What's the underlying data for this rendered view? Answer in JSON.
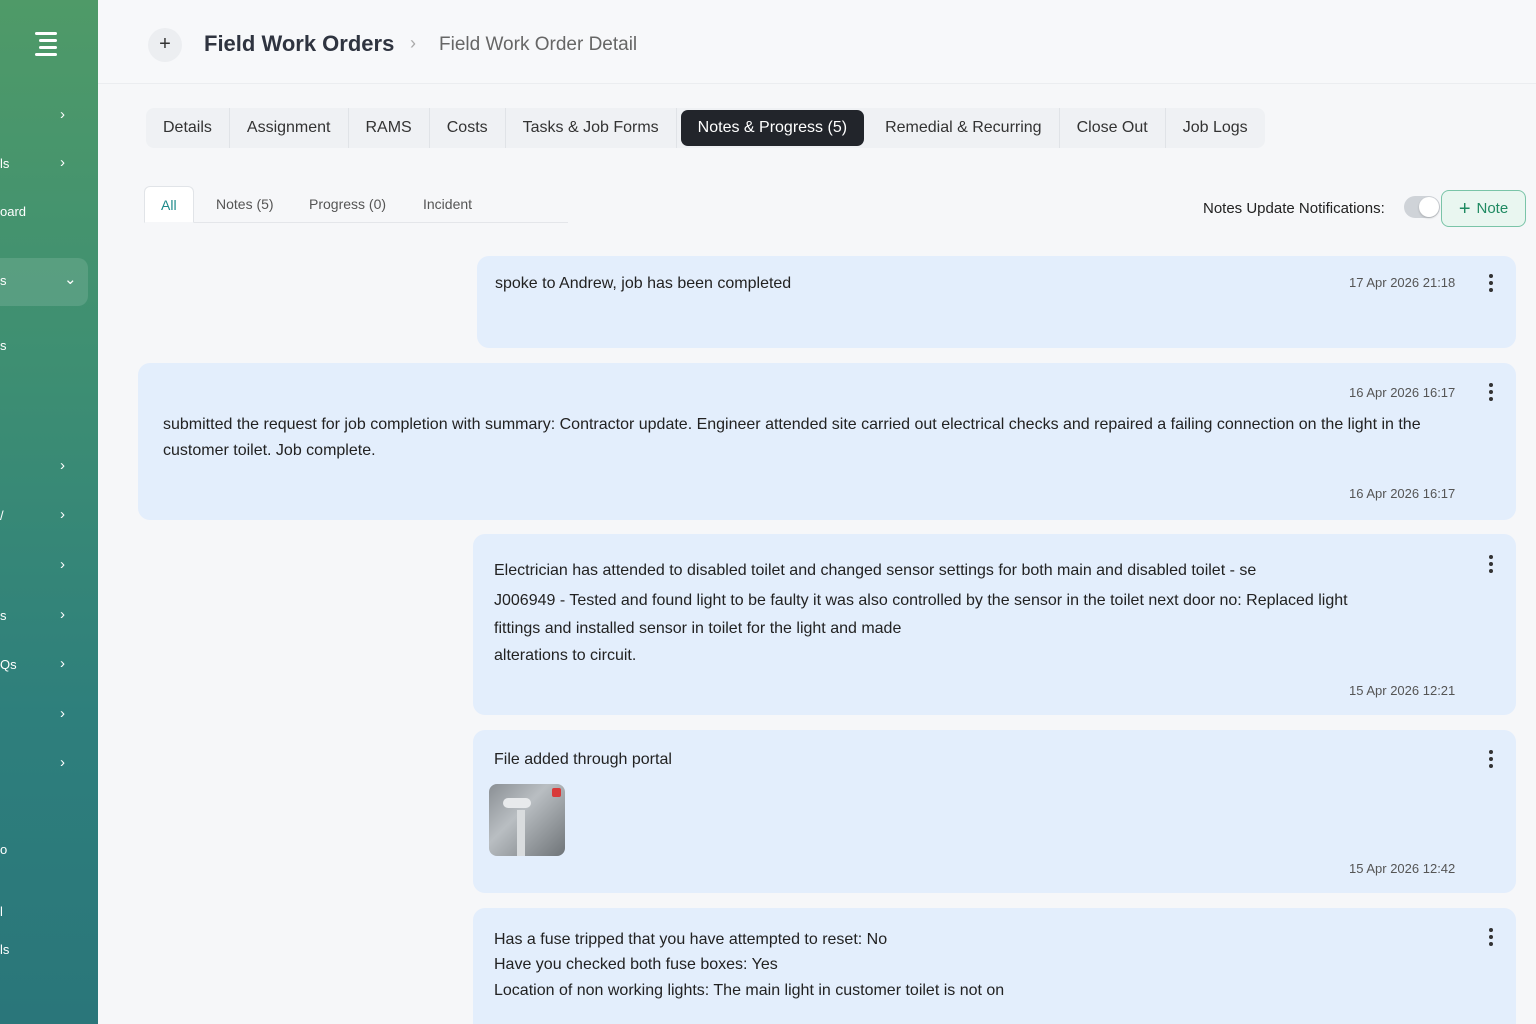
{
  "sidebar": {
    "items": [
      {
        "label": "",
        "chevron": "›"
      },
      {
        "label": "ls",
        "chevron": "›"
      },
      {
        "label": "oard",
        "chevron": ""
      },
      {
        "label": "s",
        "chevron": "⌄"
      },
      {
        "label": "s",
        "chevron": ""
      },
      {
        "label": "",
        "chevron": "›"
      },
      {
        "label": "/",
        "chevron": "›"
      },
      {
        "label": "",
        "chevron": "›"
      },
      {
        "label": "s",
        "chevron": "›"
      },
      {
        "label": "Qs",
        "chevron": "›"
      },
      {
        "label": "",
        "chevron": "›"
      },
      {
        "label": "",
        "chevron": "›"
      },
      {
        "label": "o",
        "chevron": ""
      },
      {
        "label": "l",
        "chevron": ""
      },
      {
        "label": "ls",
        "chevron": ""
      }
    ]
  },
  "header": {
    "plus": "+",
    "breadcrumb_main": "Field Work Orders",
    "breadcrumb_sep": "›",
    "breadcrumb_sub": "Field Work Order Detail"
  },
  "tabs": [
    {
      "label": "Details"
    },
    {
      "label": "Assignment"
    },
    {
      "label": "RAMS"
    },
    {
      "label": "Costs"
    },
    {
      "label": "Tasks & Job Forms"
    },
    {
      "label": "Notes & Progress (5)"
    },
    {
      "label": "Remedial & Recurring"
    },
    {
      "label": "Close Out"
    },
    {
      "label": "Job Logs"
    }
  ],
  "active_tab": "Notes & Progress (5)",
  "subtabs": [
    {
      "label": "All"
    },
    {
      "label": "Notes (5)"
    },
    {
      "label": "Progress (0)"
    },
    {
      "label": "Incident"
    }
  ],
  "notifications": {
    "label": "Notes Update Notifications:",
    "enabled": false
  },
  "add_note": {
    "icon": "+",
    "label": "Note"
  },
  "notes": [
    {
      "text": "spoke to Andrew, job has been completed",
      "timestamp": "17 Apr 2026 21:18"
    },
    {
      "text": "submitted the request for job completion with summary: Contractor update. Engineer attended site carried out electrical checks and repaired a failing connection on the light in the customer toilet. Job complete.",
      "timestamp_top": "16 Apr 2026 16:17",
      "timestamp": "16 Apr 2026 16:17"
    },
    {
      "line1": "Electrician has attended to disabled toilet and changed sensor settings for both main and disabled toilet - se",
      "line2": "J006949 - Tested and found light to be faulty it was also controlled by the sensor in the toilet next door no: Replaced light",
      "line3": "fittings and installed sensor in toilet for the light and made",
      "line4": "alterations to circuit.",
      "timestamp": "15 Apr 2026 12:21"
    },
    {
      "text": "File added through portal",
      "attachment": "thumbnail",
      "timestamp": "15 Apr 2026 12:42"
    },
    {
      "line1": "Has a fuse tripped that you have attempted to reset: No",
      "line2": "Have you checked both fuse boxes: Yes",
      "line3": "Location of non working lights: The main light in customer toilet is not on"
    }
  ]
}
